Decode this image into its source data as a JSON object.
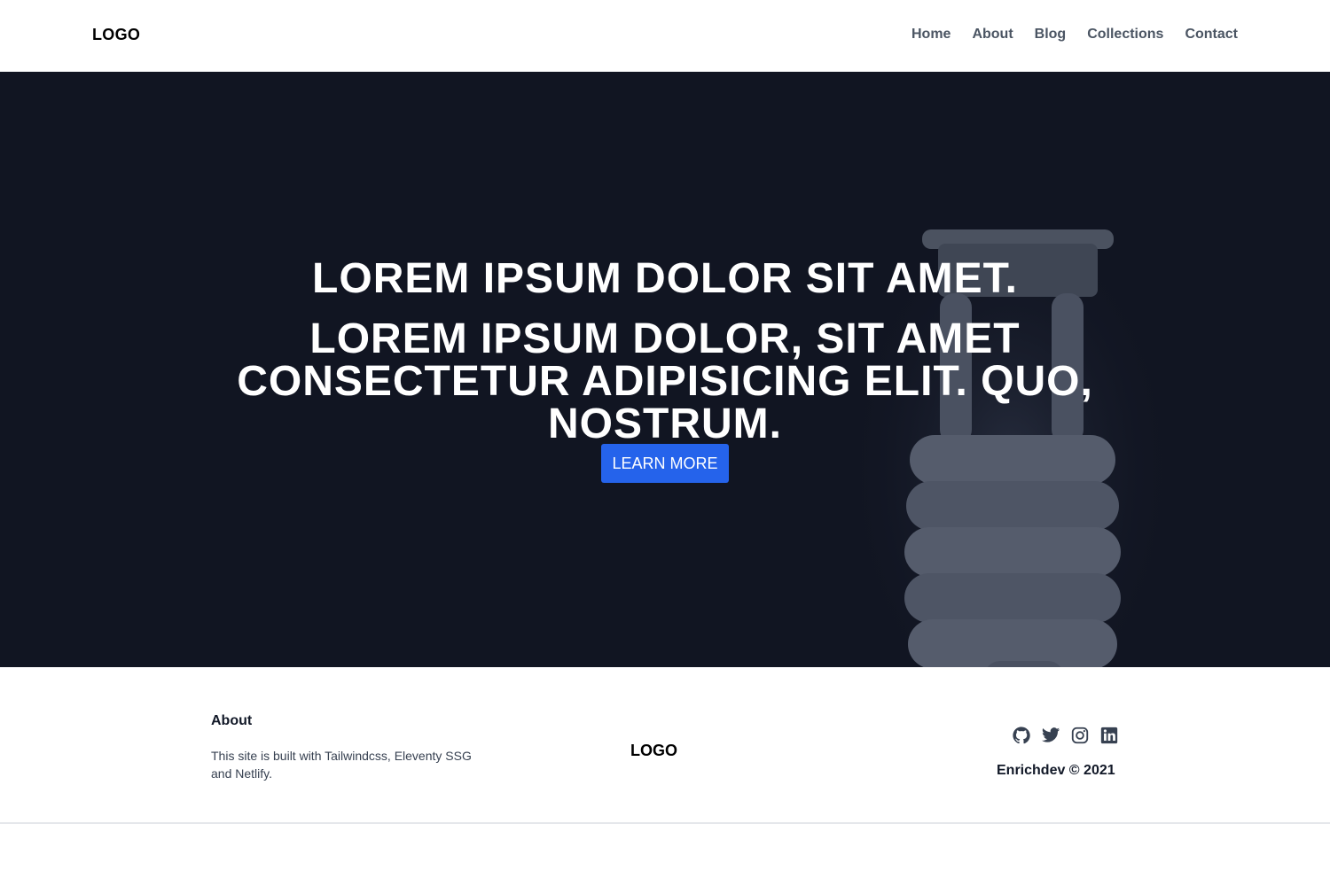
{
  "nav": {
    "logo": "LOGO",
    "links": [
      "Home",
      "About",
      "Blog",
      "Collections",
      "Contact"
    ]
  },
  "hero": {
    "title": "LOREM IPSUM DOLOR SIT AMET.",
    "subtitle": "LOREM IPSUM DOLOR, SIT AMET CONSECTETUR ADIPISICING ELIT. QUO, NOSTRUM.",
    "button_label": "LEARN MORE",
    "background_image": "lightbulb-image"
  },
  "footer": {
    "about_title": "About",
    "about_text": "This site is built with Tailwindcss, Eleventy SSG and Netlify.",
    "logo": "LOGO",
    "social_icons": [
      "github-icon",
      "twitter-icon",
      "instagram-icon",
      "linkedin-icon"
    ],
    "copyright": "Enrichdev © 2021"
  },
  "colors": {
    "hero_bg": "#111522",
    "accent": "#2563eb",
    "nav_link": "#4b5563"
  }
}
